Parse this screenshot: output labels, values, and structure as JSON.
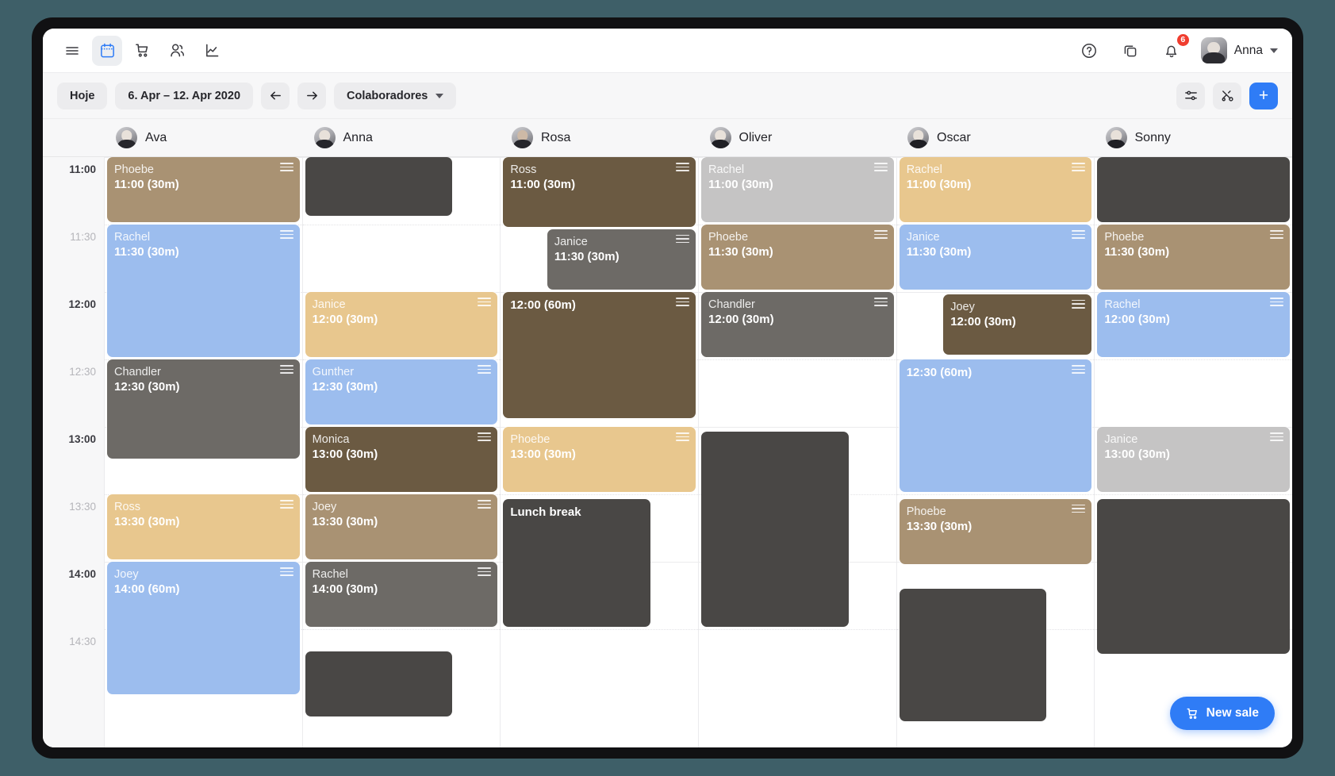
{
  "app": {
    "user_name": "Anna",
    "notification_count": "6",
    "accent_color": "#2f7cf6"
  },
  "nav": {
    "menu_label": "menu",
    "items": [
      {
        "name": "calendar",
        "label": "Calendar",
        "active": true
      },
      {
        "name": "sales",
        "label": "Sales",
        "active": false
      },
      {
        "name": "customers",
        "label": "Customers",
        "active": false
      },
      {
        "name": "analytics",
        "label": "Analytics",
        "active": false
      }
    ],
    "help_label": "Help",
    "duplicate_label": "Duplicate",
    "notifications_label": "Notifications"
  },
  "toolbar": {
    "today_label": "Hoje",
    "date_range": "6. Apr – 12. Apr 2020",
    "prev_label": "←",
    "next_label": "→",
    "view_label": "Colaboradores",
    "filter_label": "Filters",
    "tools_label": "Tools",
    "add_label": "+"
  },
  "columns": [
    {
      "name": "Ava",
      "avatar": "female"
    },
    {
      "name": "Anna",
      "avatar": "female"
    },
    {
      "name": "Rosa",
      "avatar": "female-dark"
    },
    {
      "name": "Oliver",
      "avatar": "male"
    },
    {
      "name": "Oscar",
      "avatar": "male"
    },
    {
      "name": "Sonny",
      "avatar": "male"
    }
  ],
  "time_axis": [
    {
      "label": "11:00",
      "major": true
    },
    {
      "label": "11:30",
      "major": false
    },
    {
      "label": "12:00",
      "major": true
    },
    {
      "label": "12:30",
      "major": false
    },
    {
      "label": "13:00",
      "major": true
    },
    {
      "label": "13:30",
      "major": false
    },
    {
      "label": "14:00",
      "major": true
    },
    {
      "label": "14:30",
      "major": false
    }
  ],
  "colors": {
    "tan": "#a99273",
    "blue": "#9cbdee",
    "gray": "#6d6a66",
    "gold": "#e8c78e",
    "brown": "#6b5a42",
    "lightgray": "#c5c4c4",
    "dark": "#494745"
  },
  "events": [
    {
      "col": 0,
      "who": "Phoebe",
      "when": "11:00 (30m)",
      "start": 0,
      "dur": 30,
      "color": "#a99273",
      "indent": 0
    },
    {
      "col": 0,
      "who": "Rachel",
      "when": "11:30 (30m)",
      "start": 30,
      "dur": 60,
      "color": "#9cbdee",
      "indent": 0
    },
    {
      "col": 0,
      "who": "Chandler",
      "when": "12:30 (30m)",
      "start": 90,
      "dur": 45,
      "color": "#6d6a66",
      "indent": 0
    },
    {
      "col": 0,
      "who": "Ross",
      "when": "13:30 (30m)",
      "start": 150,
      "dur": 30,
      "color": "#e8c78e",
      "indent": 0
    },
    {
      "col": 0,
      "who": "Joey",
      "when": "14:00 (60m)",
      "start": 180,
      "dur": 60,
      "color": "#9cbdee",
      "indent": 0
    },
    {
      "col": 1,
      "who": "",
      "when": "",
      "start": 0,
      "dur": 27,
      "color": "#494745",
      "indent": 0,
      "block": true,
      "narrow": true
    },
    {
      "col": 1,
      "who": "Janice",
      "when": "12:00 (30m)",
      "start": 60,
      "dur": 30,
      "color": "#e8c78e",
      "indent": 0
    },
    {
      "col": 1,
      "who": "Gunther",
      "when": "12:30 (30m)",
      "start": 90,
      "dur": 30,
      "color": "#9cbdee",
      "indent": 0
    },
    {
      "col": 1,
      "who": "Monica",
      "when": "13:00 (30m)",
      "start": 120,
      "dur": 30,
      "color": "#6b5a42",
      "indent": 0
    },
    {
      "col": 1,
      "who": "Joey",
      "when": "13:30 (30m)",
      "start": 150,
      "dur": 30,
      "color": "#a99273",
      "indent": 0
    },
    {
      "col": 1,
      "who": "Rachel",
      "when": "14:00 (30m)",
      "start": 180,
      "dur": 30,
      "color": "#6d6a66",
      "indent": 0
    },
    {
      "col": 1,
      "who": "",
      "when": "",
      "start": 220,
      "dur": 30,
      "color": "#494745",
      "indent": 0,
      "block": true,
      "narrow": true
    },
    {
      "col": 2,
      "who": "Ross",
      "when": "11:00 (30m)",
      "start": 0,
      "dur": 32,
      "color": "#6b5a42",
      "indent": 0
    },
    {
      "col": 2,
      "who": "Janice",
      "when": "11:30 (30m)",
      "start": 32,
      "dur": 28,
      "color": "#6d6a66",
      "indent": 30
    },
    {
      "col": 2,
      "who": "",
      "when": "12:00 (60m)",
      "start": 60,
      "dur": 57,
      "color": "#6b5a42",
      "indent": 0
    },
    {
      "col": 2,
      "who": "Phoebe",
      "when": "13:00 (30m)",
      "start": 120,
      "dur": 30,
      "color": "#e8c78e",
      "indent": 0
    },
    {
      "col": 2,
      "who": "Lunch break",
      "when": "",
      "start": 152,
      "dur": 58,
      "color": "#494745",
      "indent": 0,
      "block": true,
      "narrow": true
    },
    {
      "col": 3,
      "who": "Rachel",
      "when": "11:00 (30m)",
      "start": 0,
      "dur": 30,
      "color": "#c5c4c4",
      "indent": 0
    },
    {
      "col": 3,
      "who": "Phoebe",
      "when": "11:30 (30m)",
      "start": 30,
      "dur": 30,
      "color": "#a99273",
      "indent": 0
    },
    {
      "col": 3,
      "who": "Chandler",
      "when": "12:00 (30m)",
      "start": 60,
      "dur": 30,
      "color": "#6d6a66",
      "indent": 0
    },
    {
      "col": 3,
      "who": "",
      "when": "",
      "start": 122,
      "dur": 88,
      "color": "#494745",
      "indent": 0,
      "block": true,
      "narrow": true
    },
    {
      "col": 4,
      "who": "Rachel",
      "when": "11:00 (30m)",
      "start": 0,
      "dur": 30,
      "color": "#e8c78e",
      "indent": 0
    },
    {
      "col": 4,
      "who": "Janice",
      "when": "11:30 (30m)",
      "start": 30,
      "dur": 30,
      "color": "#9cbdee",
      "indent": 0
    },
    {
      "col": 4,
      "who": "Joey",
      "when": "12:00 (30m)",
      "start": 61,
      "dur": 28,
      "color": "#6b5a42",
      "indent": 30
    },
    {
      "col": 4,
      "who": "",
      "when": "12:30 (60m)",
      "start": 90,
      "dur": 60,
      "color": "#9cbdee",
      "indent": 0
    },
    {
      "col": 4,
      "who": "Phoebe",
      "when": "13:30 (30m)",
      "start": 152,
      "dur": 30,
      "color": "#a99273",
      "indent": 0
    },
    {
      "col": 4,
      "who": "",
      "when": "",
      "start": 192,
      "dur": 60,
      "color": "#494745",
      "indent": 0,
      "block": true,
      "narrow": true
    },
    {
      "col": 5,
      "who": "",
      "when": "",
      "start": 0,
      "dur": 30,
      "color": "#494745",
      "indent": 0,
      "block": true
    },
    {
      "col": 5,
      "who": "Phoebe",
      "when": "11:30 (30m)",
      "start": 30,
      "dur": 30,
      "color": "#a99273",
      "indent": 0
    },
    {
      "col": 5,
      "who": "Rachel",
      "when": "12:00 (30m)",
      "start": 60,
      "dur": 30,
      "color": "#9cbdee",
      "indent": 0
    },
    {
      "col": 5,
      "who": "Janice",
      "when": "13:00 (30m)",
      "start": 120,
      "dur": 30,
      "color": "#c5c4c4",
      "indent": 0
    },
    {
      "col": 5,
      "who": "",
      "when": "",
      "start": 152,
      "dur": 70,
      "color": "#494745",
      "indent": 0,
      "block": true
    }
  ],
  "fab": {
    "label": "New sale",
    "icon": "cart-icon"
  }
}
